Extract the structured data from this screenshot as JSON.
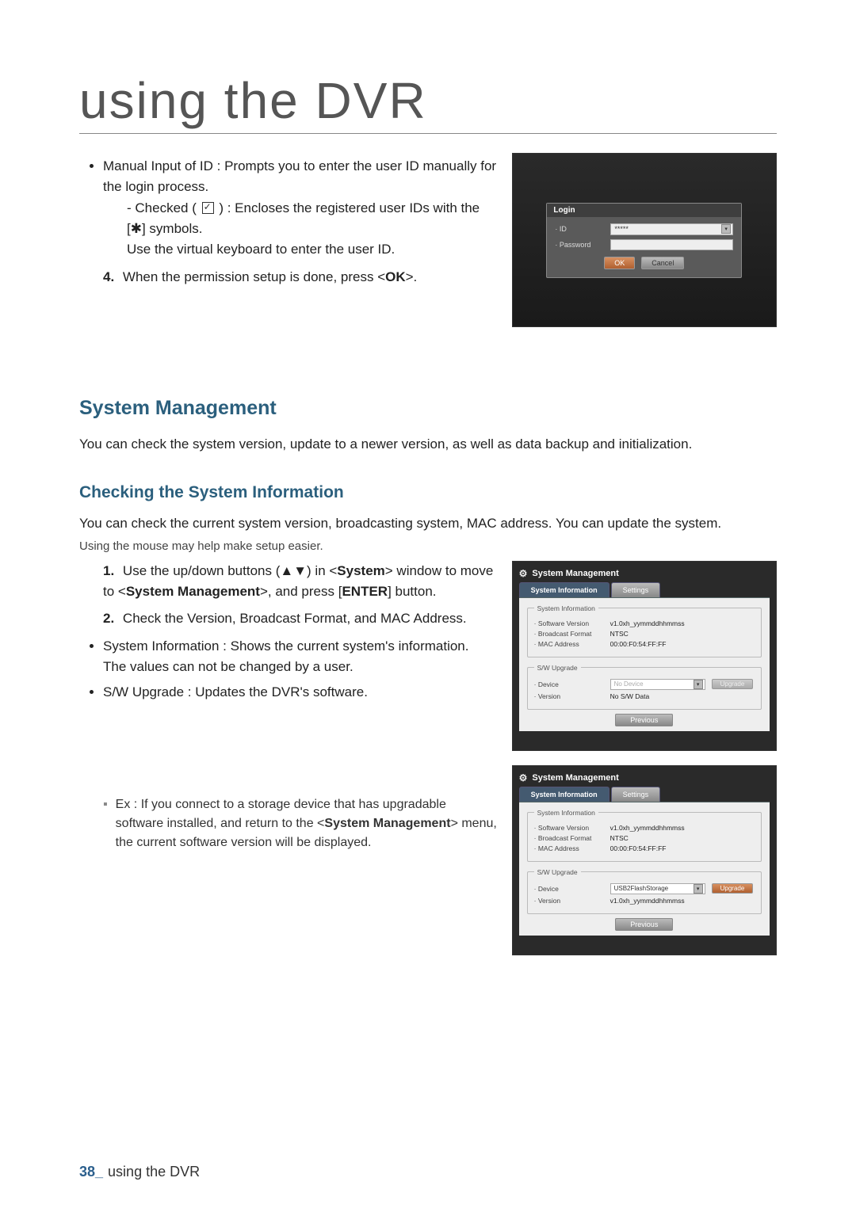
{
  "page_title": "using the DVR",
  "intro": {
    "bullet1_prefix": "Manual Input of ID : Prompts you to enter the user ID manually for the login process.",
    "sub_checked_prefix": "Checked ( ",
    "sub_checked_suffix": " ) : Encloses the registered user IDs with the [✱] symbols.",
    "sub_use_virtual": "Use the virtual keyboard to enter the user ID.",
    "step4_num": "4.",
    "step4_text_a": "When the permission setup is done, press <",
    "step4_ok": "OK",
    "step4_text_b": ">."
  },
  "login_shot": {
    "title": "Login",
    "id_label": "ID",
    "id_value": "*****",
    "pw_label": "Password",
    "ok": "OK",
    "cancel": "Cancel"
  },
  "h2_system_mgmt": "System Management",
  "p_system_mgmt": "You can check the system version, update to a newer version, as well as data backup and initialization.",
  "h3_checking": "Checking the System Information",
  "p_checking": "You can check the current system version, broadcasting system, MAC address. You can update the system.",
  "p_mouse": "Using the mouse may help make setup easier.",
  "steps": {
    "s1_num": "1.",
    "s1_a": "Use the up/down buttons (▲▼) in <",
    "s1_sys": "System",
    "s1_b": "> window to move to <",
    "s1_sm": "System Management",
    "s1_c": ">, and press [",
    "s1_enter": "ENTER",
    "s1_d": "] button.",
    "s2_num": "2.",
    "s2": "Check the Version, Broadcast Format, and MAC Address."
  },
  "bullets_after": {
    "b1": "System Information : Shows the current system's information.",
    "b1_sub": "The values can not be changed by a user.",
    "b2": "S/W Upgrade : Updates the DVR's software."
  },
  "ex": {
    "label": "Ex :",
    "text_a": "If you connect to a storage device that has upgradable software installed, and return to the <",
    "text_sm": "System Management",
    "text_b": "> menu, the current software version will be displayed."
  },
  "mgmt_shot": {
    "title": "System Management",
    "tab1": "System Information",
    "tab2": "Settings",
    "grp_sysinfo": "System Information",
    "sw_ver_label": "Software Version",
    "sw_ver_value": "v1.0xh_yymmddhhmmss",
    "bf_label": "Broadcast Format",
    "bf_value": "NTSC",
    "mac_label": "MAC Address",
    "mac_value": "00:00:F0:54:FF:FF",
    "grp_upgrade": "S/W Upgrade",
    "dev_label": "Device",
    "dev_placeholder": "No Device",
    "dev_value_connected": "USB2FlashStorage",
    "upgrade_btn": "Upgrade",
    "ver_label": "Version",
    "ver_value_none": "No S/W Data",
    "ver_value_connected": "v1.0xh_yymmddhhmmss",
    "previous": "Previous"
  },
  "footer": {
    "page": "38_",
    "text": "using the DVR"
  }
}
